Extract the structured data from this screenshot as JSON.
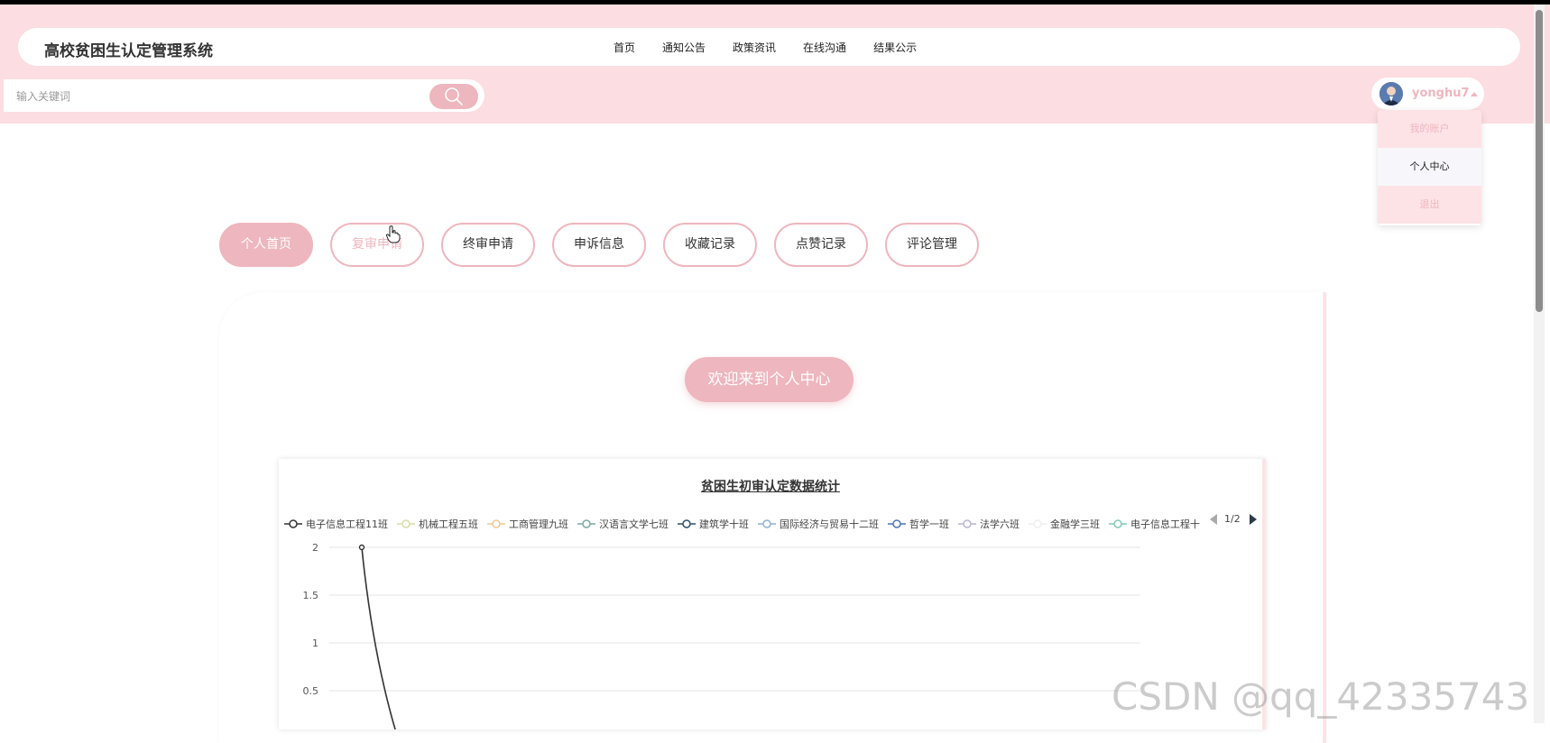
{
  "header": {
    "site_title": "高校贫困生认定管理系统",
    "nav": [
      "首页",
      "通知公告",
      "政策资讯",
      "在线沟通",
      "结果公示"
    ]
  },
  "search": {
    "placeholder": "输入关键词",
    "icon": "search-icon"
  },
  "user": {
    "username": "yonghu7",
    "menu": [
      "我的账户",
      "个人中心",
      "退出"
    ],
    "active_menu_index": 1
  },
  "tabs": {
    "items": [
      "个人首页",
      "复审申请",
      "终审申请",
      "申诉信息",
      "收藏记录",
      "点赞记录",
      "评论管理"
    ],
    "active_index": 0,
    "hover_index": 1
  },
  "welcome": {
    "text": "欢迎来到个人中心"
  },
  "colors": {
    "accent": "#eeb6be",
    "header_bg": "#fcdde1"
  },
  "chart_data": {
    "type": "line",
    "title": "贫困生初审认定数据统计",
    "legend_page": "1/2",
    "series": [
      {
        "name": "电子信息工程11班",
        "color": "#333333"
      },
      {
        "name": "机械工程五班",
        "color": "#d9dba8"
      },
      {
        "name": "工商管理九班",
        "color": "#f0c890"
      },
      {
        "name": "汉语言文学七班",
        "color": "#7ba7a5"
      },
      {
        "name": "建筑学十班",
        "color": "#2d4f6a"
      },
      {
        "name": "国际经济与贸易十二班",
        "color": "#8fb0d2"
      },
      {
        "name": "哲学一班",
        "color": "#4d73b0"
      },
      {
        "name": "法学六班",
        "color": "#b9b3d3"
      },
      {
        "name": "金融学三班",
        "color": "#eeeeee"
      },
      {
        "name": "电子信息工程十",
        "color": "#7fcab5"
      }
    ],
    "y_ticks": [
      "2",
      "1.5",
      "1",
      "0.5"
    ],
    "ylim": [
      0,
      2
    ],
    "visible_points": [
      {
        "series": "电子信息工程11班",
        "y": 2
      }
    ],
    "grid": true
  },
  "watermark": "CSDN @qq_42335743"
}
